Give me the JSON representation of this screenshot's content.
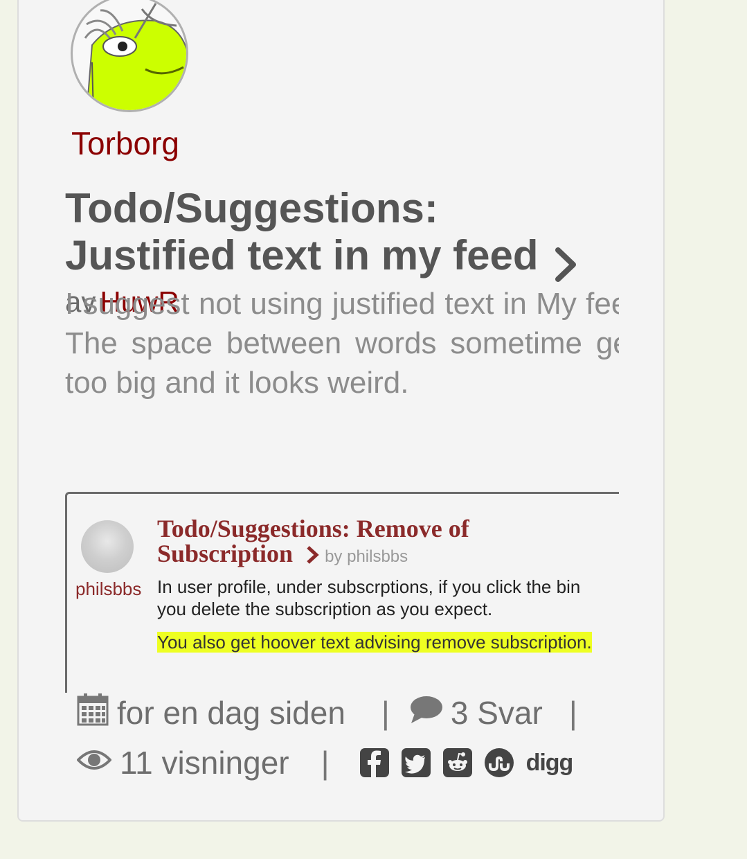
{
  "post": {
    "author": "Torborg",
    "title": "Todo/Suggestions: Justified text in my feed",
    "by_label": "av",
    "by_user": "HuwR",
    "excerpt": "I suggest not using justified text in My feed. The space between words sometime gets too big and it looks weird."
  },
  "embedded_screenshot": {
    "user": "philsbbs",
    "title": "Todo/Suggestions: Remove of Subscription",
    "by": "by philsbbs",
    "text": "In user profile, under subscrptions, if you click the bin you delete the subscription as you expect.",
    "highlighted_text": "You also get hoover text advising remove subscription."
  },
  "meta": {
    "time": "for en dag siden",
    "replies": "3 Svar",
    "views": "11 visninger",
    "separator": "|",
    "social": [
      "facebook-icon",
      "twitter-icon",
      "reddit-icon",
      "stumbleupon-icon",
      "digg"
    ],
    "digg_label": "digg"
  },
  "colors": {
    "link": "#8b0000",
    "title": "#555555",
    "highlight": "#eeff22",
    "avatar_face": "#ccff00"
  }
}
